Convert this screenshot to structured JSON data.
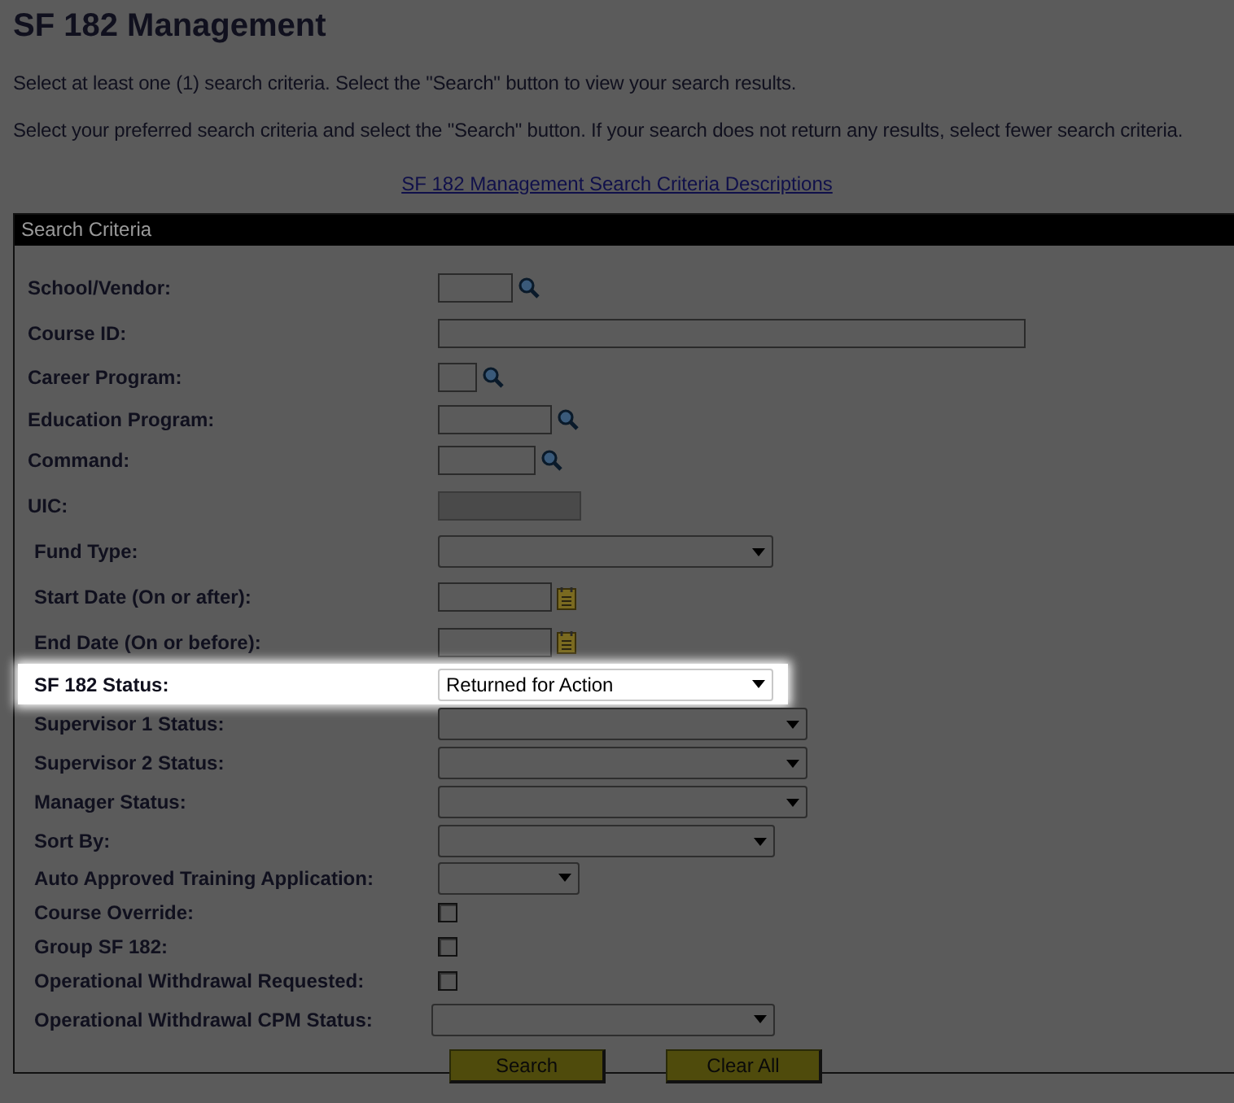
{
  "title": "SF 182 Management",
  "instructions": [
    "Select at least one (1) search criteria. Select the \"Search\" button to view your search results.",
    "Select your preferred search criteria and select the \"Search\" button. If your search does not return any results, select fewer search criteria."
  ],
  "link": "SF 182 Management Search Criteria Descriptions",
  "panel": {
    "title": "Search Criteria",
    "fields": [
      {
        "label": "School/Vendor:",
        "kind": "lookup",
        "highlighted": false
      },
      {
        "label": "Course ID:",
        "kind": "text",
        "highlighted": false
      },
      {
        "label": "Career Program:",
        "kind": "lookup",
        "highlighted": false
      },
      {
        "label": "Education Program:",
        "kind": "lookup",
        "highlighted": false
      },
      {
        "label": "Command:",
        "kind": "lookup",
        "highlighted": false
      },
      {
        "label": "UIC:",
        "kind": "readonly",
        "highlighted": false
      },
      {
        "label": "Fund Type:",
        "kind": "select",
        "highlighted": false
      },
      {
        "label": "Start Date (On or after):",
        "kind": "date",
        "highlighted": false
      },
      {
        "label": "End Date (On or before):",
        "kind": "date",
        "highlighted": false
      },
      {
        "label": "SF 182 Status:",
        "kind": "select",
        "value": "Returned for Action",
        "highlighted": true
      },
      {
        "label": "Supervisor 1 Status:",
        "kind": "select",
        "highlighted": false
      },
      {
        "label": "Supervisor 2 Status:",
        "kind": "select",
        "highlighted": false
      },
      {
        "label": "Manager Status:",
        "kind": "select",
        "highlighted": false
      },
      {
        "label": "Sort By:",
        "kind": "select",
        "highlighted": false
      },
      {
        "label": "Auto Approved Training Application:",
        "kind": "select",
        "highlighted": false
      },
      {
        "label": "Course Override:",
        "kind": "checkbox",
        "checked": false,
        "highlighted": false
      },
      {
        "label": "Group SF 182:",
        "kind": "checkbox",
        "checked": false,
        "highlighted": false
      },
      {
        "label": "Operational Withdrawal Requested:",
        "kind": "checkbox",
        "checked": false,
        "highlighted": false
      },
      {
        "label": "Operational Withdrawal CPM Status:",
        "kind": "select",
        "highlighted": false
      }
    ],
    "buttons": [
      "Search",
      "Clear All"
    ]
  }
}
